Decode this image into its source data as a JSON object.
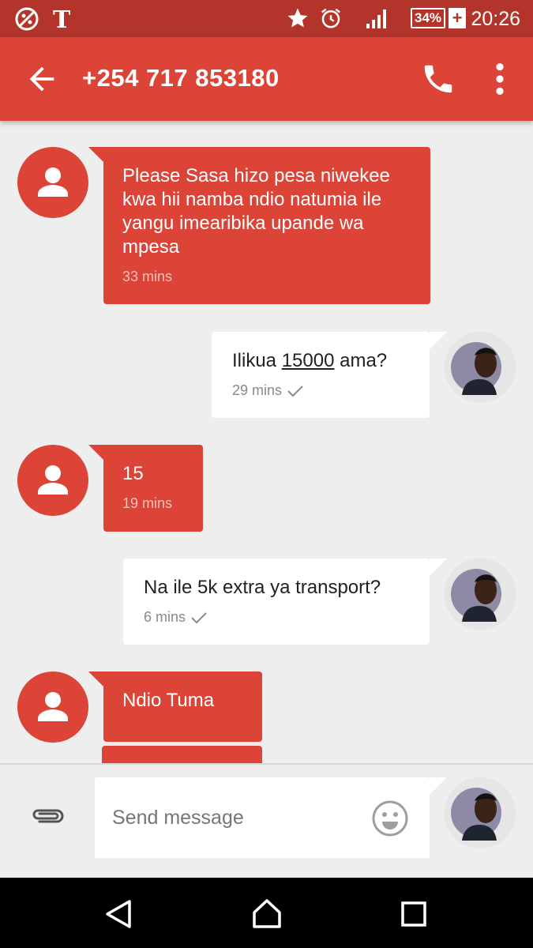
{
  "status_bar": {
    "time": "20:26",
    "battery": "34%",
    "icons": [
      "browser-app-icon",
      "nytimes-icon",
      "star-icon",
      "alarm-icon",
      "signal-icon",
      "battery-icon"
    ]
  },
  "app_bar": {
    "title": "+254 717 853180",
    "icons": [
      "back-arrow-icon",
      "phone-icon",
      "more-vert-icon"
    ]
  },
  "messages": [
    {
      "direction": "incoming",
      "text": "Please Sasa hizo pesa niwekee kwa hii namba ndio natumia ile yangu imearibika upande wa mpesa",
      "time": "33 mins"
    },
    {
      "direction": "outgoing",
      "text_before": "Ilikua ",
      "text_link": "15000",
      "text_after": " ama?",
      "time": "29 mins",
      "status": "delivered"
    },
    {
      "direction": "incoming",
      "text": "15",
      "time": "19 mins"
    },
    {
      "direction": "outgoing",
      "text": "Na ile 5k extra ya transport?",
      "time": "6 mins",
      "status": "delivered"
    },
    {
      "direction": "incoming",
      "text": "Ndio Tuma"
    }
  ],
  "composer": {
    "placeholder": "Send message",
    "icons": [
      "attachment-icon",
      "emoji-icon"
    ]
  },
  "nav_bar": {
    "icons": [
      "back-nav-icon",
      "home-nav-icon",
      "recents-nav-icon"
    ]
  },
  "colors": {
    "accent": "#db4437",
    "status_bar": "#b3342b",
    "background": "#eeeeee"
  }
}
